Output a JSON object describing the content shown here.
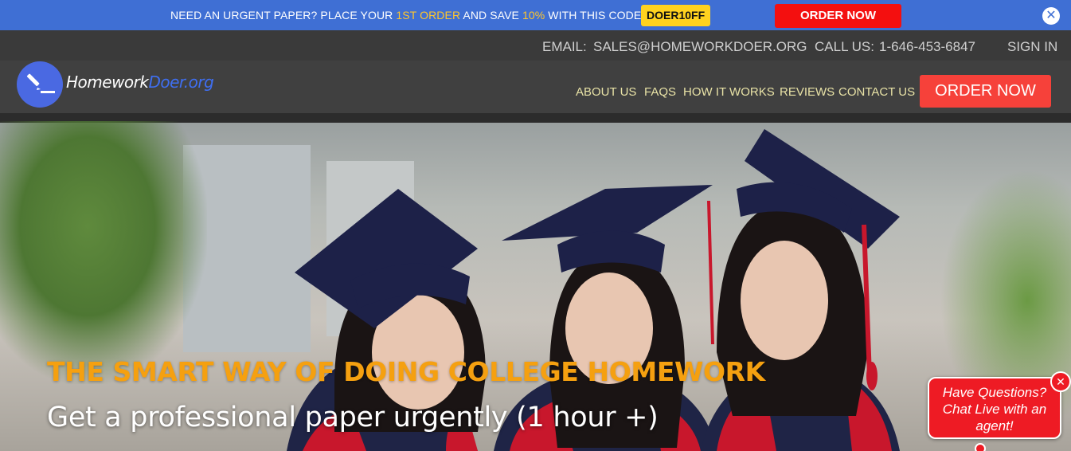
{
  "promo": {
    "text_before": "NEED AN URGENT PAPER? PLACE YOUR ",
    "highlight_order": "1ST ORDER",
    "text_middle": " AND SAVE ",
    "highlight_pct": "10%",
    "text_after": " WITH THIS CODE:",
    "code": "DOER10FF",
    "order_button": "ORDER NOW",
    "close_glyph": "✕",
    "colors": {
      "bar": "#3f6fd4",
      "highlight": "#ffc62b",
      "code_bg": "#ffd21f",
      "button": "#f40f0f"
    }
  },
  "contact": {
    "email_label": "EMAIL:",
    "email": "SALES@HOMEWORKDOER.ORG",
    "call_label": "CALL US:",
    "phone": "1-646-453-6847",
    "signin": "SIGN IN"
  },
  "nav": {
    "logo_part1": "Homework",
    "logo_part2": "Doer.org",
    "links": [
      "ABOUT US",
      "FAQS",
      "HOW IT WORKS",
      "REVIEWS",
      "CONTACT US"
    ],
    "order_button": "ORDER NOW",
    "colors": {
      "link": "#e8e2a6",
      "button": "#f6413a"
    }
  },
  "hero": {
    "title": "THE SMART WAY OF DOING COLLEGE HOMEWORK",
    "subtitle": "Get a professional paper urgently (1 hour +)",
    "colors": {
      "title": "#f5a010"
    }
  },
  "chat": {
    "line1": "Have Questions?",
    "line2": "Chat Live with an",
    "line3": "agent!",
    "close_glyph": "✕",
    "color": "#ee1b24"
  }
}
